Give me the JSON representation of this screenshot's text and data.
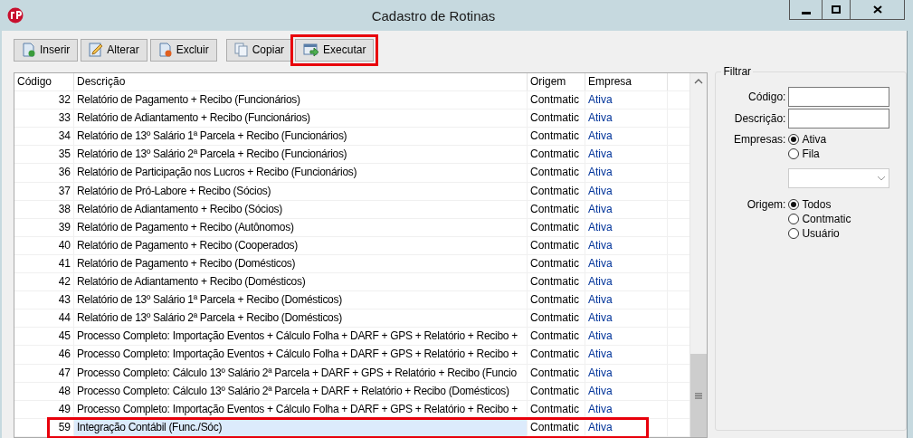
{
  "window": {
    "title": "Cadastro de Rotinas"
  },
  "toolbar": [
    {
      "label": "Inserir",
      "highlighted": false
    },
    {
      "label": "Alterar",
      "highlighted": false
    },
    {
      "label": "Excluir",
      "highlighted": false
    },
    {
      "label": "Copiar",
      "highlighted": false
    },
    {
      "label": "Executar",
      "highlighted": true
    }
  ],
  "table": {
    "columns": [
      "Código",
      "Descrição",
      "Origem",
      "Empresa"
    ],
    "rows": [
      {
        "cells": [
          "32",
          "Relatório de Pagamento + Recibo (Funcionários)",
          "Contmatic",
          "Ativa"
        ],
        "selected": false,
        "highlighted": false
      },
      {
        "cells": [
          "33",
          "Relatório de Adiantamento + Recibo (Funcionários)",
          "Contmatic",
          "Ativa"
        ],
        "selected": false,
        "highlighted": false
      },
      {
        "cells": [
          "34",
          "Relatório de 13º Salário 1ª Parcela + Recibo (Funcionários)",
          "Contmatic",
          "Ativa"
        ],
        "selected": false,
        "highlighted": false
      },
      {
        "cells": [
          "35",
          "Relatório de 13º Salário 2ª Parcela + Recibo (Funcionários)",
          "Contmatic",
          "Ativa"
        ],
        "selected": false,
        "highlighted": false
      },
      {
        "cells": [
          "36",
          "Relatório de Participação nos Lucros + Recibo (Funcionários)",
          "Contmatic",
          "Ativa"
        ],
        "selected": false,
        "highlighted": false
      },
      {
        "cells": [
          "37",
          "Relatório de Pró-Labore + Recibo (Sócios)",
          "Contmatic",
          "Ativa"
        ],
        "selected": false,
        "highlighted": false
      },
      {
        "cells": [
          "38",
          "Relatório de Adiantamento + Recibo (Sócios)",
          "Contmatic",
          "Ativa"
        ],
        "selected": false,
        "highlighted": false
      },
      {
        "cells": [
          "39",
          "Relatório de Pagamento + Recibo (Autônomos)",
          "Contmatic",
          "Ativa"
        ],
        "selected": false,
        "highlighted": false
      },
      {
        "cells": [
          "40",
          "Relatório de Pagamento + Recibo (Cooperados)",
          "Contmatic",
          "Ativa"
        ],
        "selected": false,
        "highlighted": false
      },
      {
        "cells": [
          "41",
          "Relatório de Pagamento + Recibo (Domésticos)",
          "Contmatic",
          "Ativa"
        ],
        "selected": false,
        "highlighted": false
      },
      {
        "cells": [
          "42",
          "Relatório de Adiantamento + Recibo (Domésticos)",
          "Contmatic",
          "Ativa"
        ],
        "selected": false,
        "highlighted": false
      },
      {
        "cells": [
          "43",
          "Relatório de 13º Salário 1ª Parcela + Recibo (Domésticos)",
          "Contmatic",
          "Ativa"
        ],
        "selected": false,
        "highlighted": false
      },
      {
        "cells": [
          "44",
          "Relatório de 13º Salário 2ª Parcela + Recibo (Domésticos)",
          "Contmatic",
          "Ativa"
        ],
        "selected": false,
        "highlighted": false
      },
      {
        "cells": [
          "45",
          "Processo Completo: Importação Eventos + Cálculo Folha + DARF + GPS + Relatório + Recibo +",
          "Contmatic",
          "Ativa"
        ],
        "selected": false,
        "highlighted": false
      },
      {
        "cells": [
          "46",
          "Processo Completo: Importação Eventos + Cálculo Folha + DARF + GPS + Relatório + Recibo +",
          "Contmatic",
          "Ativa"
        ],
        "selected": false,
        "highlighted": false
      },
      {
        "cells": [
          "47",
          "Processo Completo: Cálculo 13º Salário 2ª Parcela + DARF + GPS + Relatório + Recibo (Funcio",
          "Contmatic",
          "Ativa"
        ],
        "selected": false,
        "highlighted": false
      },
      {
        "cells": [
          "48",
          "Processo Completo: Cálculo 13º Salário 2ª Parcela + DARF + Relatório + Recibo (Domésticos)",
          "Contmatic",
          "Ativa"
        ],
        "selected": false,
        "highlighted": false
      },
      {
        "cells": [
          "49",
          "Processo Completo: Importação Eventos + Cálculo Folha + DARF + GPS + Relatório + Recibo +",
          "Contmatic",
          "Ativa"
        ],
        "selected": false,
        "highlighted": false
      },
      {
        "cells": [
          "59",
          "Integração Contábil (Func./Sóc)",
          "Contmatic",
          "Ativa"
        ],
        "selected": true,
        "highlighted": true
      }
    ]
  },
  "filter": {
    "title": "Filtrar",
    "fields": [
      {
        "label": "Código:"
      },
      {
        "label": "Descrição:"
      }
    ],
    "empresas": {
      "label": "Empresas:",
      "options": [
        {
          "label": "Ativa",
          "selected": true
        },
        {
          "label": "Fila",
          "selected": false
        }
      ]
    },
    "origem": {
      "label": "Origem:",
      "options": [
        {
          "label": "Todos",
          "selected": true
        },
        {
          "label": "Contmatic",
          "selected": false
        },
        {
          "label": "Usuário",
          "selected": false
        }
      ]
    }
  }
}
